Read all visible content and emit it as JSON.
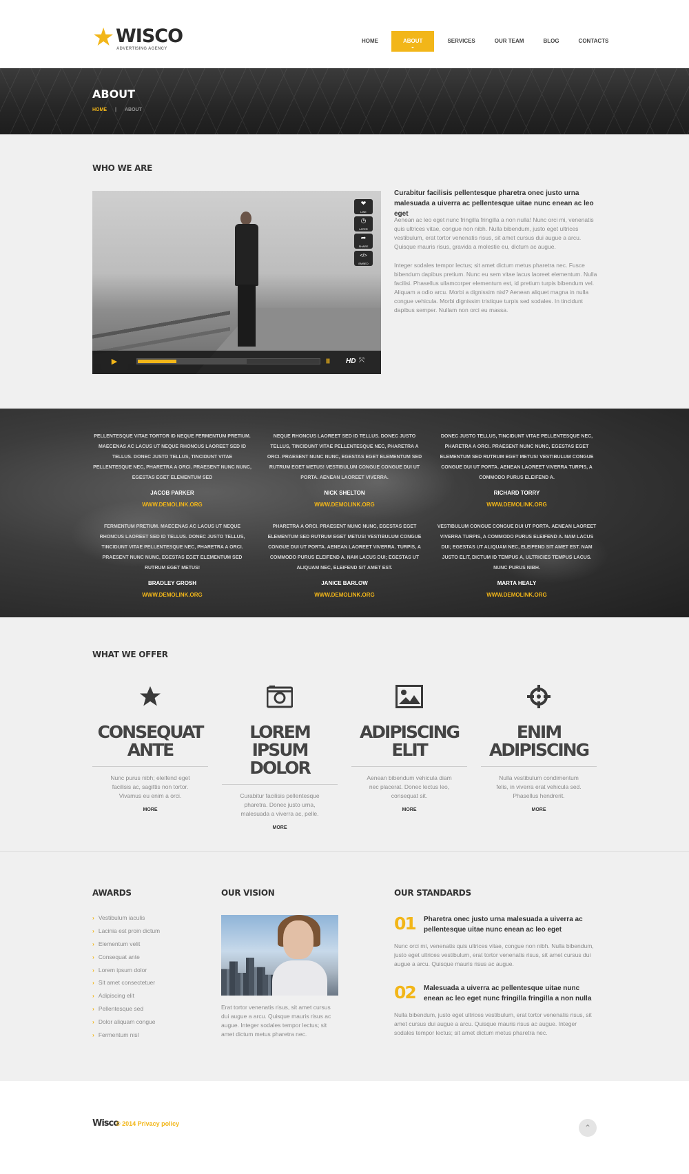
{
  "logo": {
    "name": "WISCO",
    "tagline": "ADVERTISING AGENCY"
  },
  "nav": [
    {
      "label": "HOME"
    },
    {
      "label": "ABOUT"
    },
    {
      "label": "SERVICES"
    },
    {
      "label": "OUR TEAM"
    },
    {
      "label": "BLOG"
    },
    {
      "label": "CONTACTS"
    }
  ],
  "nav_active": "ABOUT",
  "banner": {
    "title": "ABOUT",
    "crumb_home": "HOME",
    "crumb_sep": "|",
    "crumb_current": "ABOUT"
  },
  "who": {
    "title": "WHO WE ARE",
    "heading": "Curabitur facilisis pellentesque pharetra onec justo urna malesuada a uiverra ac pellentesque uitae nunc enean ac leo eget",
    "p1": "Aenean ac leo eget nunc fringilla fringilla a non nulla! Nunc orci mi, venenatis quis ultrices vitae, congue non nibh. Nulla bibendum, justo eget ultrices vestibulum, erat tortor venenatis risus, sit amet cursus dui augue a arcu. Quisque mauris risus, gravida a molestie eu, dictum ac augue.",
    "p2": "Integer sodales tempor lectus; sit amet dictum metus pharetra nec. Fusce bibendum dapibus pretium. Nunc eu sem vitae lacus laoreet elementum. Nulla facilisi. Phasellus ullamcorper elementum est, id pretium turpis bibendum vel. Aliquam a odio arcu. Morbi a dignissim nisl? Aenean aliquet magna in nulla congue vehicula. Morbi dignissim tristique turpis sed sodales. In tincidunt dapibus semper. Nullam non orci eu massa.",
    "video": {
      "side_buttons": [
        {
          "glyph": "❤",
          "label": "LIKE"
        },
        {
          "glyph": "◷",
          "label": "LATER"
        },
        {
          "glyph": "➦",
          "label": "SHARE"
        },
        {
          "glyph": "</>",
          "label": "EMBED"
        }
      ],
      "play_glyph": "▶",
      "progress": 0.21,
      "buffered": 0.6,
      "volume_glyph": "||||||",
      "hd_label": "HD",
      "fullscreen_glyph": "⤧"
    }
  },
  "testimonials": [
    {
      "text": "PELLENTESQUE VITAE TORTOR ID NEQUE FERMENTUM PRETIUM. MAECENAS AC LACUS UT NEQUE RHONCUS LAOREET SED ID TELLUS. DONEC JUSTO TELLUS, TINCIDUNT VITAE PELLENTESQUE NEC, PHARETRA A ORCI. PRAESENT NUNC NUNC, EGESTAS EGET ELEMENTUM SED",
      "name": "JACOB PARKER",
      "link": "WWW.DEMOLINK.ORG"
    },
    {
      "text": "NEQUE RHONCUS LAOREET SED ID TELLUS. DONEC JUSTO TELLUS, TINCIDUNT VITAE PELLENTESQUE NEC, PHARETRA A ORCI. PRAESENT NUNC NUNC, EGESTAS EGET ELEMENTUM SED RUTRUM EGET METUS! VESTIBULUM CONGUE CONGUE DUI UT PORTA. AENEAN LAOREET VIVERRA.",
      "name": "NICK SHELTON",
      "link": "WWW.DEMOLINK.ORG"
    },
    {
      "text": "DONEC JUSTO TELLUS, TINCIDUNT VITAE PELLENTESQUE NEC, PHARETRA A ORCI. PRAESENT NUNC NUNC, EGESTAS EGET ELEMENTUM SED RUTRUM EGET METUS! VESTIBULUM CONGUE CONGUE DUI UT PORTA. AENEAN LAOREET VIVERRA TURPIS, A COMMODO PURUS ELEIFEND A.",
      "name": "RICHARD TORRY",
      "link": "WWW.DEMOLINK.ORG"
    },
    {
      "text": "FERMENTUM PRETIUM. MAECENAS AC LACUS UT NEQUE RHONCUS LAOREET SED ID TELLUS. DONEC JUSTO TELLUS, TINCIDUNT VITAE PELLENTESQUE NEC, PHARETRA A ORCI. PRAESENT NUNC NUNC, EGESTAS EGET ELEMENTUM SED RUTRUM EGET METUS!",
      "name": "BRADLEY GROSH",
      "link": "WWW.DEMOLINK.ORG"
    },
    {
      "text": "PHARETRA A ORCI. PRAESENT NUNC NUNC, EGESTAS EGET ELEMENTUM SED RUTRUM EGET METUS! VESTIBULUM CONGUE CONGUE DUI UT PORTA. AENEAN LAOREET VIVERRA. TURPIS, A COMMODO PURUS ELEIFEND A. NAM LACUS DUI; EGESTAS UT ALIQUAM NEC, ELEIFEND SIT AMET EST.",
      "name": "JANICE BARLOW",
      "link": "WWW.DEMOLINK.ORG"
    },
    {
      "text": "VESTIBULUM CONGUE CONGUE DUI UT PORTA. AENEAN LAOREET VIVERRA TURPIS, A COMMODO PURUS ELEIFEND A. NAM LACUS DUI; EGESTAS UT ALIQUAM NEC, ELEIFEND SIT AMET EST. NAM JUSTO ELIT, DICTUM ID TEMPUS A, ULTRICIES TEMPUS LACUS. NUNC PURUS NIBH.",
      "name": "MARTA HEALY",
      "link": "WWW.DEMOLINK.ORG"
    }
  ],
  "offer": {
    "title": "WHAT WE OFFER",
    "items": [
      {
        "icon": "star-icon",
        "line1": "CONSEQUAT",
        "line2": "ANTE",
        "desc": "Nunc purus nibh; eleifend eget facilisis ac, sagittis non tortor. Vivamus eu enim a orci.",
        "more": "MORE"
      },
      {
        "icon": "camera-icon",
        "line1": "LOREM IPSUM",
        "line2": "DOLOR",
        "desc": "Curabitur facilisis pellentesque pharetra. Donec justo urna, malesuada a viverra ac, pelle.",
        "more": "MORE"
      },
      {
        "icon": "image-icon",
        "line1": "ADIPISCING",
        "line2": "ELIT",
        "desc": "Aenean bibendum vehicula diam nec placerat. Donec lectus leo, consequat sit.",
        "more": "MORE"
      },
      {
        "icon": "target-icon",
        "line1": "ENIM",
        "line2": "ADIPISCING",
        "desc": "Nulla vestibulum condimentum felis, in viverra erat vehicula sed. Phasellus hendrerit.",
        "more": "MORE"
      }
    ]
  },
  "awards": {
    "title": "AWARDS",
    "items": [
      "Vestibulum iaculis",
      "Lacinia est proin dictum",
      "Elementum velit",
      "Consequat ante",
      "Lorem ipsum dolor",
      "Sit amet consectetuer",
      "Adipiscing elit",
      "Pellentesque sed",
      "Dolor aliquam congue",
      "Fermentum nisl"
    ]
  },
  "vision": {
    "title": "OUR VISION",
    "text": "Erat tortor venenatis risus, sit amet cursus dui augue a arcu. Quisque mauris risus ac augue. Integer sodales tempor lectus; sit amet dictum metus pharetra nec."
  },
  "standards": {
    "title": "OUR STANDARDS",
    "items": [
      {
        "num": "01",
        "heading": "Pharetra onec justo urna malesuada a uiverra ac pellentesque uitae nunc enean ac leo eget",
        "text": "Nunc orci mi, venenatis quis ultrices vitae, congue non nibh. Nulla bibendum, justo eget ultrices vestibulum, erat tortor venenatis risus, sit amet cursus dui augue a arcu. Quisque mauris risus ac augue."
      },
      {
        "num": "02",
        "heading": "Malesuada a uiverra ac pellentesque uitae nunc enean ac leo eget nunc fringilla fringilla a non nulla",
        "text": "Nulla bibendum, justo eget ultrices vestibulum, erat tortor venenatis risus, sit amet cursus dui augue a arcu. Quisque mauris risus ac augue. Integer sodales tempor lectus; sit amet dictum metus pharetra nec."
      }
    ]
  },
  "footer": {
    "brand": "Wisco",
    "copy": "© 2014 Privacy policy",
    "top_glyph": "⌃"
  },
  "colors": {
    "accent": "#f2b619",
    "dark": "#2b2b2b",
    "text_muted": "#8a8a8a"
  }
}
